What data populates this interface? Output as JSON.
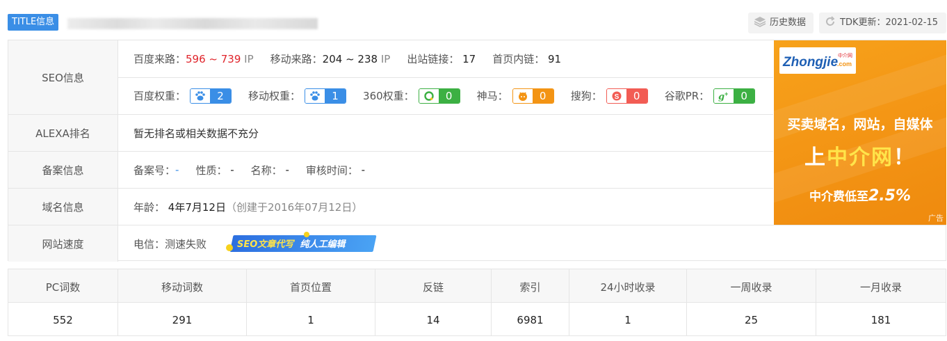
{
  "title_row": {
    "tag": "TITLE信息",
    "history_label": "历史数据",
    "tdk_label": "TDK更新：2021-02-15"
  },
  "seo": {
    "label": "SEO信息",
    "row1": [
      {
        "key": "百度来路：",
        "value": "596 ~ 739",
        "unit": "IP"
      },
      {
        "key": "移动来路：",
        "value": "204 ~ 238",
        "unit": "IP"
      },
      {
        "key": "出站链接：",
        "value": "17"
      },
      {
        "key": "首页内链：",
        "value": "91"
      }
    ],
    "weights": [
      {
        "key": "百度权重：",
        "value": "2",
        "icon": "baidu-paw-icon",
        "color": "#3a8ee6"
      },
      {
        "key": "移动权重：",
        "value": "1",
        "icon": "mobile-paw-icon",
        "color": "#3a8ee6"
      },
      {
        "key": "360权重：",
        "value": "0",
        "icon": "360-icon",
        "color": "#3cb043"
      },
      {
        "key": "神马：",
        "value": "0",
        "icon": "shenma-icon",
        "color": "#f39414"
      },
      {
        "key": "搜狗：",
        "value": "0",
        "icon": "sogou-icon",
        "color": "#f25c54"
      },
      {
        "key": "谷歌PR：",
        "value": "0",
        "icon": "google-plus-icon",
        "color": "#3cb043"
      }
    ]
  },
  "alexa": {
    "label": "ALEXA排名",
    "value": "暂无排名或相关数据不充分"
  },
  "beian": {
    "label": "备案信息",
    "fields": [
      {
        "key": "备案号：",
        "value": "-"
      },
      {
        "key": "性质：",
        "value": "-"
      },
      {
        "key": "名称：",
        "value": "-"
      },
      {
        "key": "审核时间：",
        "value": "-"
      }
    ]
  },
  "domain": {
    "label": "域名信息",
    "age_key": "年龄：",
    "age_value": "4年7月12日",
    "created": "（创建于2016年07月12日）"
  },
  "speed": {
    "label": "网站速度",
    "value": "电信：测速失败",
    "banner_a": "SEO文章代写",
    "banner_b": "纯人工编辑"
  },
  "ad": {
    "logo_text": "Zhongjie",
    "logo_sub": ".com",
    "logo_cn": "中介网",
    "line1": "买卖域名，网站，自媒体",
    "line2_a": "上",
    "line2_b": "中介网",
    "line2_c": "！",
    "line3_a": "中介费低至",
    "line3_b": "2.5%",
    "tag": "广告"
  },
  "stats": {
    "headers": [
      "PC词数",
      "移动词数",
      "首页位置",
      "反链",
      "索引",
      "24小时收录",
      "一周收录",
      "一月收录"
    ],
    "values": [
      "552",
      "291",
      "1",
      "14",
      "6981",
      "1",
      "25",
      "181"
    ]
  }
}
